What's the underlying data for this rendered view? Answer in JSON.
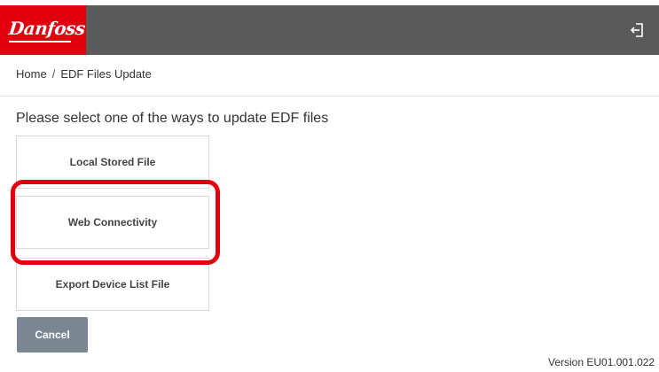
{
  "header": {
    "logo_text": "Danfoss",
    "logout_icon": "logout-icon",
    "background_color": "#5a5a5a",
    "brand_color": "#e2000f"
  },
  "breadcrumb": {
    "home": "Home",
    "separator": "/",
    "current": "EDF Files Update"
  },
  "main": {
    "prompt": "Please select one of the ways to update EDF files",
    "options": [
      {
        "label": "Local Stored File"
      },
      {
        "label": "Web Connectivity"
      },
      {
        "label": "Export Device List File"
      }
    ],
    "cancel_label": "Cancel"
  },
  "footer": {
    "version": "Version EU01.001.022"
  },
  "annotation": {
    "highlight_color": "#e2000f"
  }
}
